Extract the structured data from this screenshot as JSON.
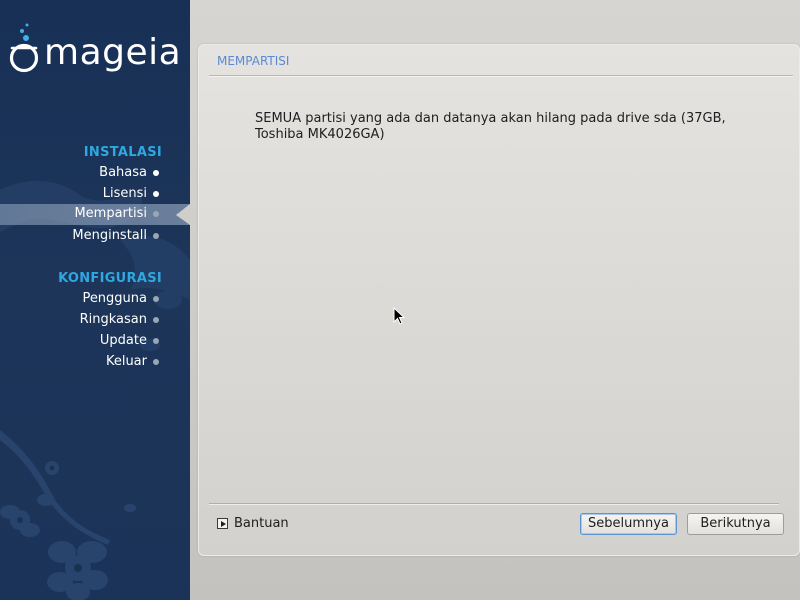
{
  "sidebar": {
    "logo_text": "mageia",
    "sections": [
      {
        "heading": "INSTALASI",
        "items": [
          {
            "label": "Bahasa",
            "state": "done"
          },
          {
            "label": "Lisensi",
            "state": "done"
          },
          {
            "label": "Mempartisi",
            "state": "active"
          },
          {
            "label": "Menginstall",
            "state": "pending"
          }
        ]
      },
      {
        "heading": "KONFIGURASI",
        "items": [
          {
            "label": "Pengguna",
            "state": "pending"
          },
          {
            "label": "Ringkasan",
            "state": "pending"
          },
          {
            "label": "Update",
            "state": "pending"
          },
          {
            "label": "Keluar",
            "state": "pending"
          }
        ]
      }
    ]
  },
  "panel": {
    "title": "MEMPARTISI",
    "message": "SEMUA partisi yang ada dan datanya akan hilang pada drive sda (37GB, Toshiba MK4026GA)",
    "help_label": "Bantuan",
    "prev_label": "Sebelumnya",
    "next_label": "Berikutnya"
  },
  "colors": {
    "sidebar_bg": "#1c3559",
    "section_heading": "#2fa7e0",
    "panel_title": "#5b8ad0",
    "default_button_border": "#5e93cf"
  },
  "icons": {
    "help_toggle": "disclosure-triangle-right-icon",
    "cursor": "mouse-pointer-icon"
  }
}
